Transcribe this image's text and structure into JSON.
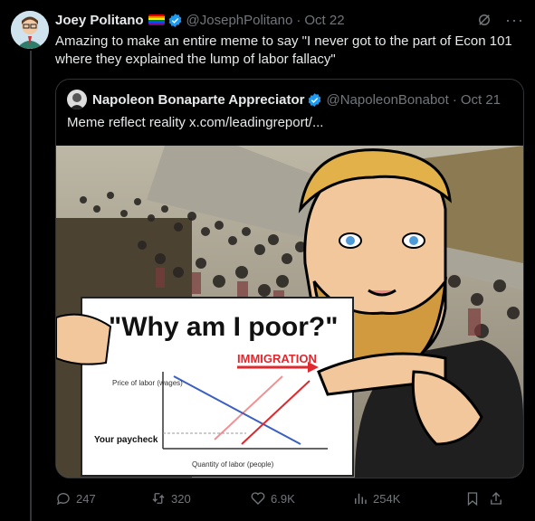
{
  "tweet": {
    "author_name": "Joey Politano",
    "handle": "@JosephPolitano",
    "separator": "·",
    "date": "Oct 22",
    "text": "Amazing to make an entire meme to say \"I never got to the part of Econ 101 where they explained the lump of labor fallacy\""
  },
  "quote": {
    "author_name": "Napoleon Bonaparte Appreciator",
    "handle": "@NapoleonBonabot",
    "separator": "·",
    "date": "Oct 21",
    "text": "Meme reflect reality  x.com/leadingreport/..."
  },
  "meme": {
    "sign_title": "\"Why am I poor?\"",
    "immigration": "IMMIGRATION",
    "price_label": "Price of labor (wages)",
    "paycheck_label": "Your paycheck",
    "quantity_label": "Quantity of labor (people)"
  },
  "actions": {
    "replies": "247",
    "reposts": "320",
    "likes": "6.9K",
    "views": "254K"
  },
  "colors": {
    "background": "#000000",
    "accent": "#1d9bf0",
    "muted": "#71767b",
    "red": "#e0282e"
  }
}
